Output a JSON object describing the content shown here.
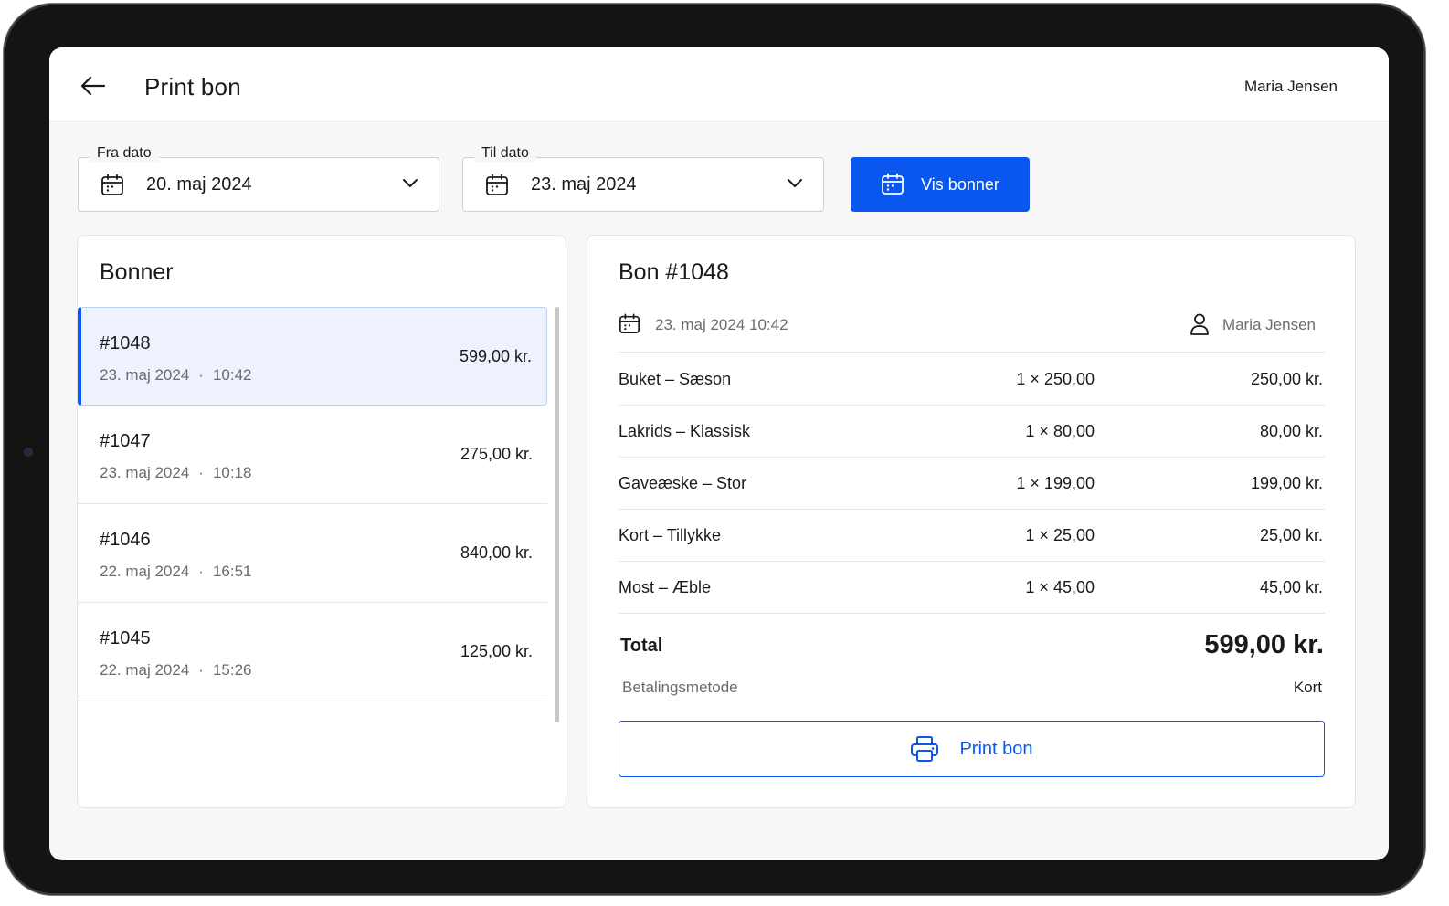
{
  "header": {
    "title": "Print bon",
    "user": "Maria Jensen"
  },
  "filters": {
    "from": {
      "label": "Fra dato",
      "value": "20. maj 2024"
    },
    "to": {
      "label": "Til dato",
      "value": "23. maj 2024"
    },
    "show_button": "Vis bonner"
  },
  "list": {
    "title": "Bonner",
    "items": [
      {
        "number": "#1048",
        "date": "23. maj 2024",
        "time": "10:42",
        "amount": "599,00 kr."
      },
      {
        "number": "#1047",
        "date": "23. maj 2024",
        "time": "10:18",
        "amount": "275,00 kr."
      },
      {
        "number": "#1046",
        "date": "22. maj 2024",
        "time": "16:51",
        "amount": "840,00 kr."
      },
      {
        "number": "#1045",
        "date": "22. maj 2024",
        "time": "15:26",
        "amount": "125,00 kr."
      }
    ]
  },
  "detail": {
    "title": "Bon #1048",
    "datetime": "23. maj 2024 10:42",
    "user": "Maria Jensen",
    "lines": [
      {
        "name": "Buket – Sæson",
        "qty": "1 × 250,00",
        "sum": "250,00 kr."
      },
      {
        "name": "Lakrids – Klassisk",
        "qty": "1 × 80,00",
        "sum": "80,00 kr."
      },
      {
        "name": "Gaveæske – Stor",
        "qty": "1 × 199,00",
        "sum": "199,00 kr."
      },
      {
        "name": "Kort – Tillykke",
        "qty": "1 × 25,00",
        "sum": "25,00 kr."
      },
      {
        "name": "Most – Æble",
        "qty": "1 × 45,00",
        "sum": "45,00 kr."
      }
    ],
    "total_label": "Total",
    "total_value": "599,00 kr.",
    "payment_label": "Betalingsmetode",
    "payment_value": "Kort",
    "print_button": "Print bon"
  },
  "colors": {
    "accent": "#0a57f0",
    "selected_bg": "#edf2fd",
    "muted_text": "#6b6b70"
  },
  "icons": {
    "back": "arrow-left-icon",
    "calendar": "calendar-icon",
    "chevron": "chevron-down-icon",
    "user": "user-icon",
    "printer": "printer-icon"
  }
}
